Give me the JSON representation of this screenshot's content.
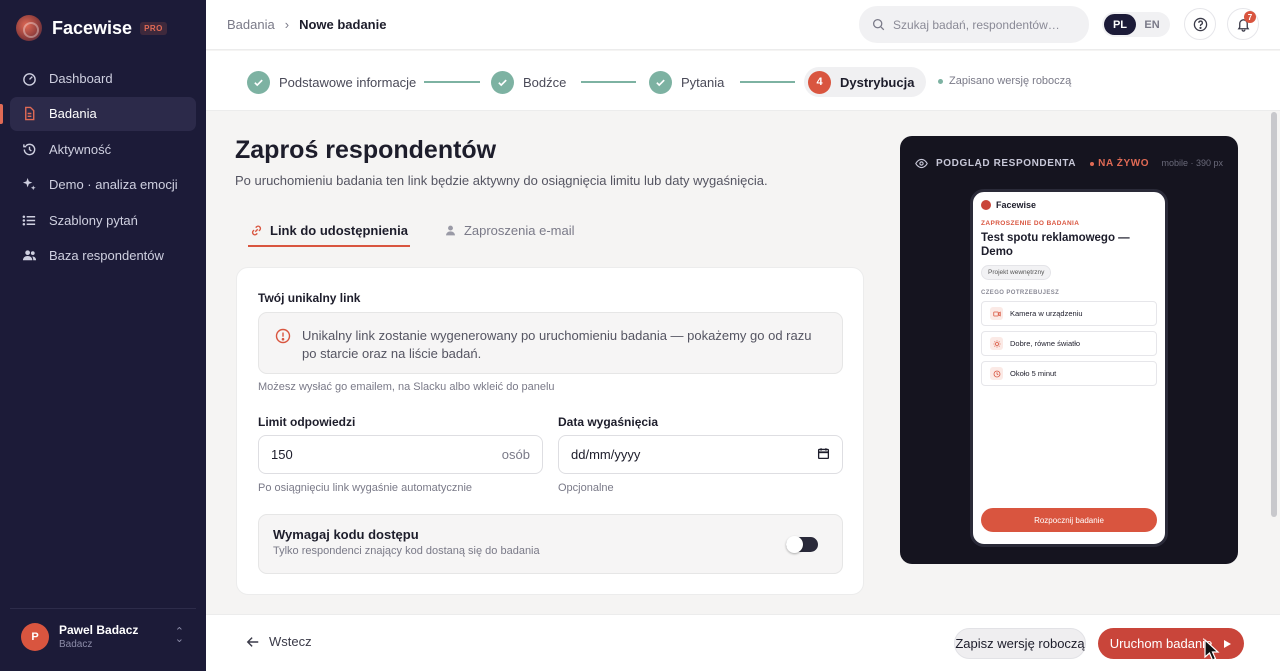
{
  "app": {
    "name": "Facewise",
    "badge": "PRO"
  },
  "sidebar": {
    "items": [
      {
        "label": "Dashboard",
        "icon": "gauge-icon",
        "active": false
      },
      {
        "label": "Badania",
        "icon": "document-icon",
        "active": true
      },
      {
        "label": "Aktywność",
        "icon": "history-icon",
        "active": false
      },
      {
        "label": "Demo · analiza emocji",
        "icon": "sparkles-icon",
        "active": false
      },
      {
        "label": "Szablony pytań",
        "icon": "list-icon",
        "active": false
      },
      {
        "label": "Baza respondentów",
        "icon": "users-icon",
        "active": false
      }
    ],
    "user": {
      "initial": "P",
      "name": "Pawel Badacz",
      "role": "Badacz"
    }
  },
  "topbar": {
    "breadcrumb": [
      "Badania",
      "Nowe badanie"
    ],
    "search_placeholder": "Szukaj badań, respondentów…",
    "languages": [
      "PL",
      "EN"
    ],
    "active_language": "PL",
    "notification_count": "7"
  },
  "stepper": {
    "steps": [
      {
        "label": "Podstawowe informacje",
        "state": "done"
      },
      {
        "label": "Bodźce",
        "state": "done"
      },
      {
        "label": "Pytania",
        "state": "done"
      },
      {
        "label": "Dystrybucja",
        "number": "4",
        "state": "current"
      }
    ],
    "draft_status": "Zapisano wersję roboczą"
  },
  "main": {
    "title": "Zaproś respondentów",
    "subtitle": "Po uruchomieniu badania ten link będzie aktywny do osiągnięcia limitu lub daty wygaśnięcia.",
    "tabs": [
      {
        "label": "Link do udostępnienia",
        "active": true
      },
      {
        "label": "Zaproszenia e-mail",
        "active": false
      }
    ],
    "link_section": {
      "label": "Twój unikalny link",
      "info": "Unikalny link zostanie wygenerowany po uruchomieniu badania — pokażemy go od razu po starcie oraz na liście badań.",
      "hint": "Możesz wysłać go emailem, na Slacku albo wkleić do panelu"
    },
    "limit": {
      "label": "Limit odpowiedzi",
      "value": "150",
      "suffix": "osób",
      "hint": "Po osiągnięciu link wygaśnie automatycznie"
    },
    "expiry": {
      "label": "Data wygaśnięcia",
      "placeholder": "dd/mm/yyyy",
      "hint": "Opcjonalne"
    },
    "access_code": {
      "title": "Wymagaj kodu dostępu",
      "description": "Tylko respondenci znający kod dostaną się do badania",
      "enabled": false
    }
  },
  "preview": {
    "heading": "PODGLĄD RESPONDENTA",
    "live": "NA ŻYWO",
    "meta": "mobile · 390 px",
    "phone": {
      "brand": "Facewise",
      "kicker": "ZAPROSZENIE DO BADANIA",
      "title": "Test spotu reklamowego — Demo",
      "chip": "Projekt wewnętrzny",
      "section": "CZEGO POTRZEBUJESZ",
      "requirements": [
        {
          "label": "Kamera w urządzeniu",
          "icon": "camera-icon"
        },
        {
          "label": "Dobre, równe światło",
          "icon": "sun-icon"
        },
        {
          "label": "Około 5 minut",
          "icon": "clock-icon"
        }
      ],
      "cta": "Rozpocznij badanie"
    }
  },
  "footer": {
    "back": "Wstecz",
    "save_draft": "Zapisz wersję roboczą",
    "launch": "Uruchom badanie"
  },
  "colors": {
    "accent": "#d9553f",
    "sidebar_bg": "#1c1b38",
    "success": "#7db2a2"
  }
}
